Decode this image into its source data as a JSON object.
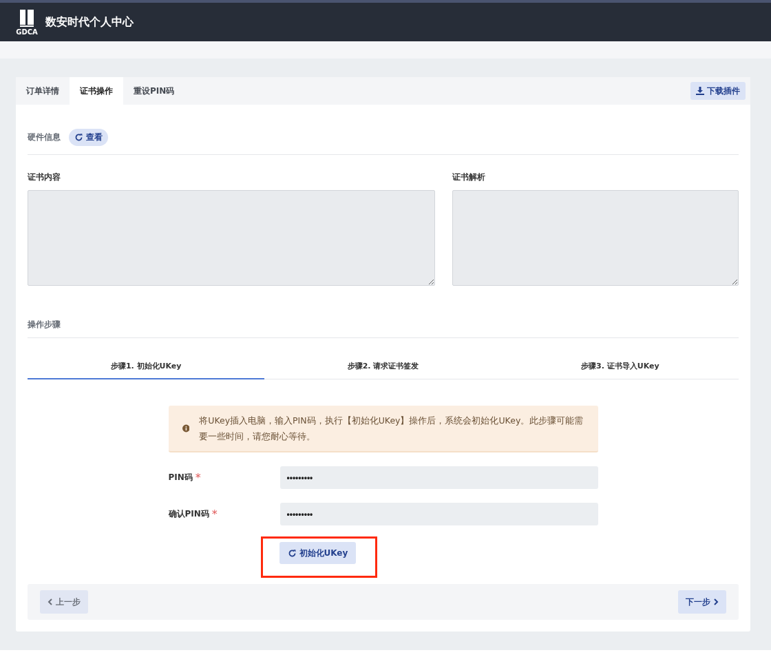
{
  "header": {
    "logo_text": "GDCA",
    "title": "数安时代个人中心"
  },
  "tabs": [
    {
      "label": "订单详情",
      "selected": false
    },
    {
      "label": "证书操作",
      "selected": true
    },
    {
      "label": "重设PIN码",
      "selected": false
    }
  ],
  "download_button": "下载插件",
  "hardware": {
    "label": "硬件信息",
    "button": "查看"
  },
  "cert_content": {
    "label": "证书内容"
  },
  "cert_parse": {
    "label": "证书解析"
  },
  "steps_title": "操作步骤",
  "steps": [
    {
      "label": "步骤1. 初始化UKey",
      "selected": true
    },
    {
      "label": "步骤2. 请求证书签发",
      "selected": false
    },
    {
      "label": "步骤3. 证书导入UKey",
      "selected": false
    }
  ],
  "notice": "将UKey插入电脑，输入PIN码，执行【初始化UKey】操作后，系统会初始化UKey。此步骤可能需要一些时间，请您耐心等待。",
  "fields": [
    {
      "label": "PIN码",
      "required_mark": "*",
      "value": "•••••••••"
    },
    {
      "label": "确认PIN码",
      "required_mark": "*",
      "value": "•••••••••"
    }
  ],
  "init_button": {
    "label": "初始化UKey",
    "highlighted": true
  },
  "prev_button": {
    "label": "上一步",
    "disabled": true
  },
  "next_button": {
    "label": "下一步",
    "disabled": false
  }
}
